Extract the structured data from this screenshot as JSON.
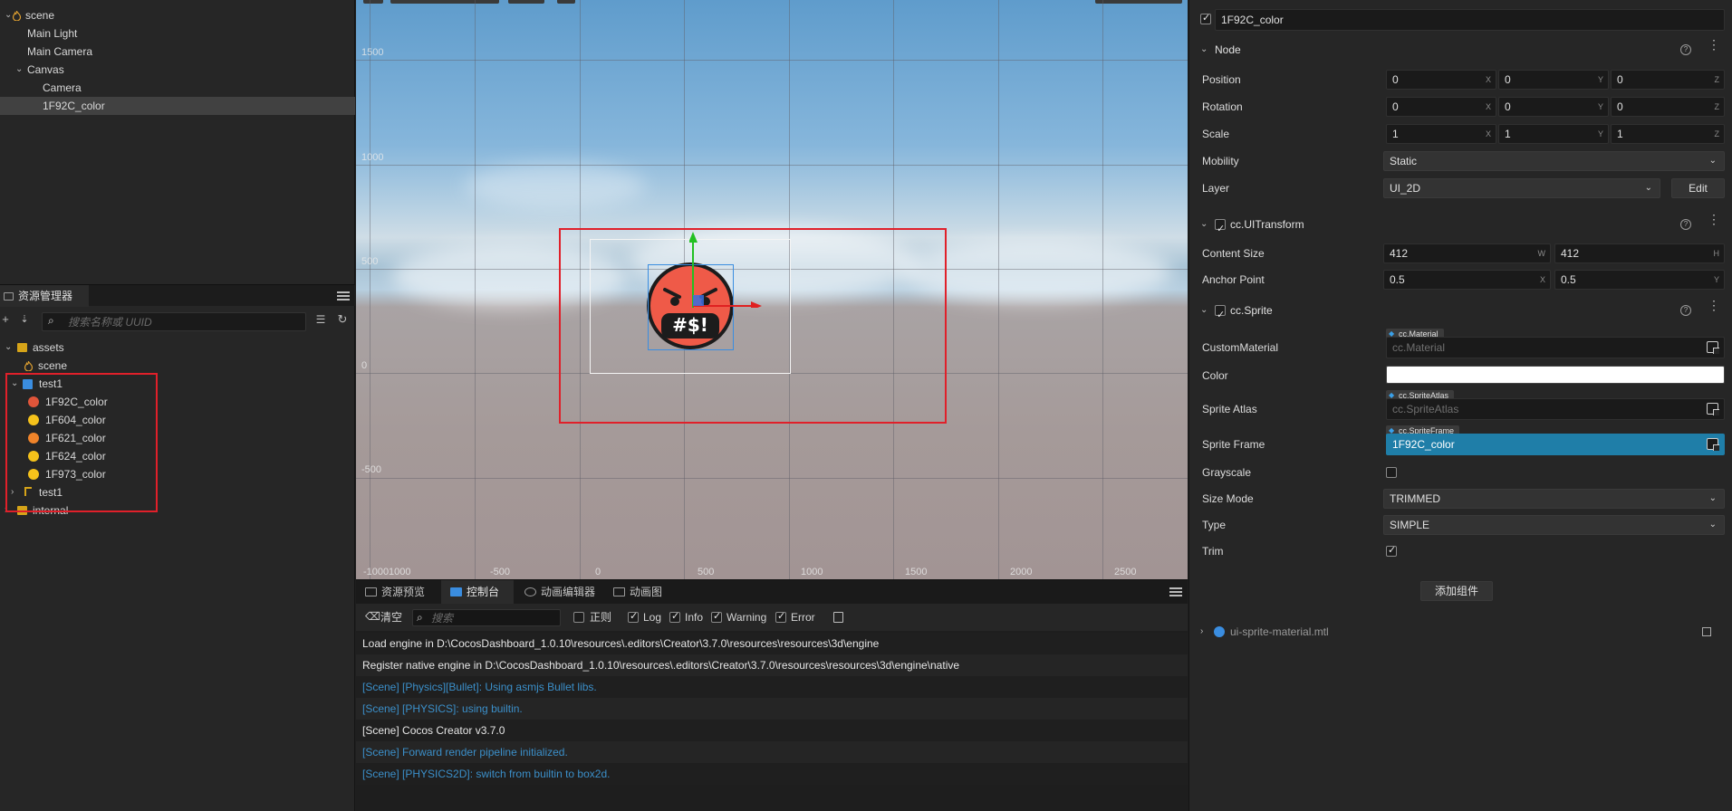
{
  "hierarchy": {
    "items": [
      {
        "label": "scene",
        "depth": 0
      },
      {
        "label": "Main Light",
        "depth": 1
      },
      {
        "label": "Main Camera",
        "depth": 1
      },
      {
        "label": "Canvas",
        "depth": 1
      },
      {
        "label": "Camera",
        "depth": 2
      },
      {
        "label": "1F92C_color",
        "depth": 2,
        "selected": true
      }
    ]
  },
  "assets": {
    "tab_label": "资源管理器",
    "search_placeholder": "搜索名称或 UUID",
    "items": [
      {
        "label": "assets",
        "type": "folder"
      },
      {
        "label": "scene",
        "type": "scene"
      },
      {
        "label": "test1",
        "type": "atlas"
      },
      {
        "label": "1F92C_color",
        "type": "emoji"
      },
      {
        "label": "1F604_color",
        "type": "emoji"
      },
      {
        "label": "1F621_color",
        "type": "emoji"
      },
      {
        "label": "1F624_color",
        "type": "emoji"
      },
      {
        "label": "1F973_color",
        "type": "emoji"
      },
      {
        "label": "test1",
        "type": "file"
      },
      {
        "label": "internal",
        "type": "folder"
      }
    ]
  },
  "scene_view": {
    "y_axis_labels": [
      "1500",
      "1000",
      "500",
      "0",
      "-500"
    ],
    "x_axis_labels": [
      "-1000",
      "1000",
      "-500",
      "0",
      "500",
      "1000",
      "1500",
      "2000",
      "2500"
    ],
    "emoji_text": "#$!",
    "colors": {
      "selection_rect": "#e0202a",
      "gizmo_x": "#e02020",
      "gizmo_y": "#20c020",
      "node_bounds": "#3a8de0"
    }
  },
  "console": {
    "tabs": [
      "资源预览",
      "控制台",
      "动画编辑器",
      "动画图"
    ],
    "active_tab": "控制台",
    "clear_label": "清空",
    "search_placeholder": "搜索",
    "filters": {
      "regex": "正则",
      "log": "Log",
      "info": "Info",
      "warning": "Warning",
      "error": "Error"
    },
    "lines": [
      {
        "text": "Load engine in D:\\CocosDashboard_1.0.10\\resources\\.editors\\Creator\\3.7.0\\resources\\resources\\3d\\engine",
        "level": "log"
      },
      {
        "text": "Register native engine in D:\\CocosDashboard_1.0.10\\resources\\.editors\\Creator\\3.7.0\\resources\\resources\\3d\\engine\\native",
        "level": "log"
      },
      {
        "text": "[Scene] [Physics][Bullet]: Using asmjs Bullet libs.",
        "level": "info"
      },
      {
        "text": "[Scene] [PHYSICS]: using builtin.",
        "level": "info"
      },
      {
        "text": "[Scene] Cocos Creator v3.7.0",
        "level": "log"
      },
      {
        "text": "[Scene] Forward render pipeline initialized.",
        "level": "info"
      },
      {
        "text": "[Scene] [PHYSICS2D]: switch from builtin to box2d.",
        "level": "info"
      }
    ],
    "colors": {
      "log": "#e6e6e6",
      "info": "#3b8fc9"
    }
  },
  "inspector": {
    "node_name": "1F92C_color",
    "node_section": "Node",
    "position": {
      "label": "Position",
      "x": "0",
      "y": "0",
      "z": "0"
    },
    "rotation": {
      "label": "Rotation",
      "x": "0",
      "y": "0",
      "z": "0"
    },
    "scale": {
      "label": "Scale",
      "x": "1",
      "y": "1",
      "z": "1"
    },
    "mobility": {
      "label": "Mobility",
      "value": "Static"
    },
    "layer": {
      "label": "Layer",
      "value": "UI_2D",
      "edit": "Edit"
    },
    "ui_transform": {
      "title": "cc.UITransform",
      "content_size": {
        "label": "Content Size",
        "w": "412",
        "h": "412"
      },
      "anchor_point": {
        "label": "Anchor Point",
        "x": "0.5",
        "y": "0.5"
      }
    },
    "sprite": {
      "title": "cc.Sprite",
      "custom_material": {
        "label": "CustomMaterial",
        "tag": "cc.Material",
        "placeholder": "cc.Material"
      },
      "color": {
        "label": "Color",
        "value": "#ffffff"
      },
      "sprite_atlas": {
        "label": "Sprite Atlas",
        "tag": "cc.SpriteAtlas",
        "placeholder": "cc.SpriteAtlas"
      },
      "sprite_frame": {
        "label": "Sprite Frame",
        "tag": "cc.SpriteFrame",
        "value": "1F92C_color"
      },
      "grayscale": {
        "label": "Grayscale",
        "checked": false
      },
      "size_mode": {
        "label": "Size Mode",
        "value": "TRIMMED"
      },
      "type": {
        "label": "Type",
        "value": "SIMPLE"
      },
      "trim": {
        "label": "Trim",
        "checked": true
      }
    },
    "add_component": "添加组件",
    "material": "ui-sprite-material.mtl",
    "colors": {
      "sprite_frame_bg": "#1f7ea8"
    }
  }
}
